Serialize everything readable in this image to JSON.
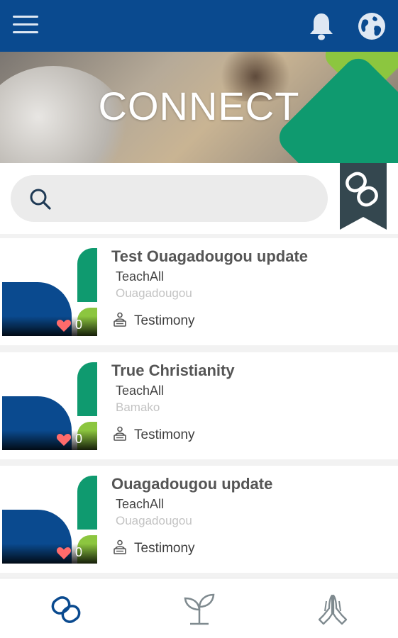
{
  "app": {
    "brand_colors": {
      "primary_blue": "#0a4a8f",
      "green": "#0f9a6f",
      "lime": "#8cc63f"
    }
  },
  "header": {
    "menu_icon": "hamburger-menu-icon",
    "notifications_icon": "bell-icon",
    "language_icon": "globe-icon"
  },
  "hero": {
    "title": "CONNECT"
  },
  "search": {
    "placeholder": "",
    "value": "",
    "icon": "search-icon",
    "bookmark_icon": "link-bookmark-icon"
  },
  "posts": [
    {
      "title": "Test Ouagadougou update",
      "organization": "TeachAll",
      "city": "Ouagadougou",
      "likes": "0",
      "type": "Testimony",
      "type_icon": "testimony-icon"
    },
    {
      "title": "True Christianity",
      "organization": "TeachAll",
      "city": "Bamako",
      "likes": "0",
      "type": "Testimony",
      "type_icon": "testimony-icon"
    },
    {
      "title": "Ouagadougou update",
      "organization": "TeachAll",
      "city": "Ouagadougou",
      "likes": "0",
      "type": "Testimony",
      "type_icon": "testimony-icon"
    }
  ],
  "bottom_nav": [
    {
      "id": "connect",
      "icon": "link-icon",
      "active": true
    },
    {
      "id": "grow",
      "icon": "sprout-icon",
      "active": false
    },
    {
      "id": "pray",
      "icon": "praying-hands-icon",
      "active": false
    }
  ]
}
